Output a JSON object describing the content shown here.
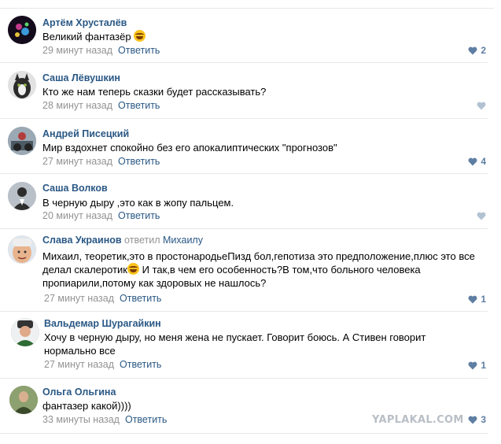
{
  "comments": [
    {
      "author": "Артём Хрусталёв",
      "text": "Великий фантазёр",
      "time": "29 минут назад",
      "reply_label": "Ответить",
      "likes": "2"
    },
    {
      "author": "Саша Лёвушкин",
      "text": "Кто же нам теперь сказки будет рассказывать?",
      "time": "28 минут назад",
      "reply_label": "Ответить",
      "likes": ""
    },
    {
      "author": "Андрей Писецкий",
      "text": "Мир вздохнет спокойно без его апокалиптических \"прогнозов\"",
      "time": "27 минут назад",
      "reply_label": "Ответить",
      "likes": "4"
    },
    {
      "author": "Саша Волков",
      "text": "В черную дыру ,это как в жопу пальцем.",
      "time": "20 минут назад",
      "reply_label": "Ответить",
      "likes": ""
    },
    {
      "author": "Слава Украинов",
      "replied_word": "ответил",
      "replied_to": "Михаилу",
      "text_line1": "Михаил, теоретик,это в простонародьеПизд  бол,гепотиза это предположение,плюс это все",
      "text_line2_a": "делал скалеротик",
      "text_line2_b": " И так,в чем его особенность?В том,что больного человека",
      "text_line3": "пропиарили,потому как здоровых не нашлось?",
      "time": "27 минут назад",
      "reply_label": "Ответить",
      "likes": "1"
    },
    {
      "author": "Вальдемар Шурагайкин",
      "text_line1": "Хочу в черную дыру, но меня жена не пускает. Говорит боюсь. А Стивен говорит",
      "text_line2": "нормально все",
      "time": "27 минут назад",
      "reply_label": "Ответить",
      "likes": "1"
    },
    {
      "author": "Ольга Ольгина",
      "text": "фантазер какой))))",
      "time": "33 минуты назад",
      "reply_label": "Ответить",
      "likes": "3"
    }
  ],
  "watermark": "YAPLAKAL.COM",
  "colors": {
    "link": "#2a5885",
    "meta": "#939393",
    "like": "#5f7ea3",
    "separator": "#e7e8ec"
  }
}
